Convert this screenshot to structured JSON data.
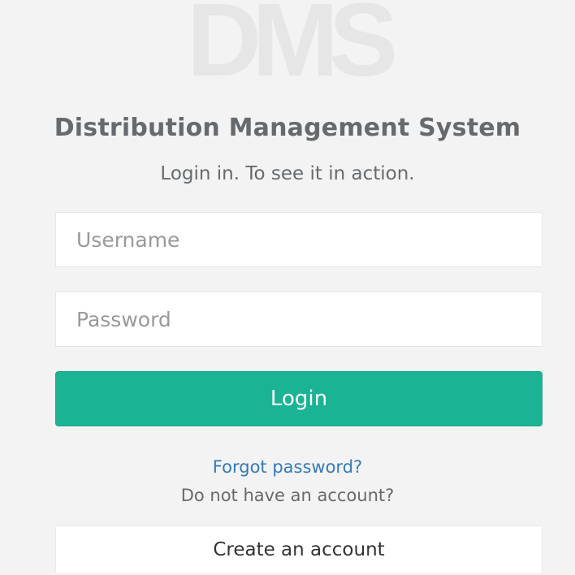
{
  "logo": {
    "text": "DMS",
    "color": "#e6e6e6"
  },
  "header": {
    "title": "Distribution Management System",
    "subtitle": "Login in. To see it in action."
  },
  "form": {
    "username_placeholder": "Username",
    "username_value": "",
    "password_placeholder": "Password",
    "password_value": "",
    "login_label": "Login"
  },
  "links": {
    "forgot_password": "Forgot password?",
    "no_account": "Do not have an account?",
    "create_account": "Create an account"
  },
  "colors": {
    "background": "#f3f3f4",
    "primary": "#1ab394",
    "link": "#337ab7",
    "text": "#676a6c"
  }
}
